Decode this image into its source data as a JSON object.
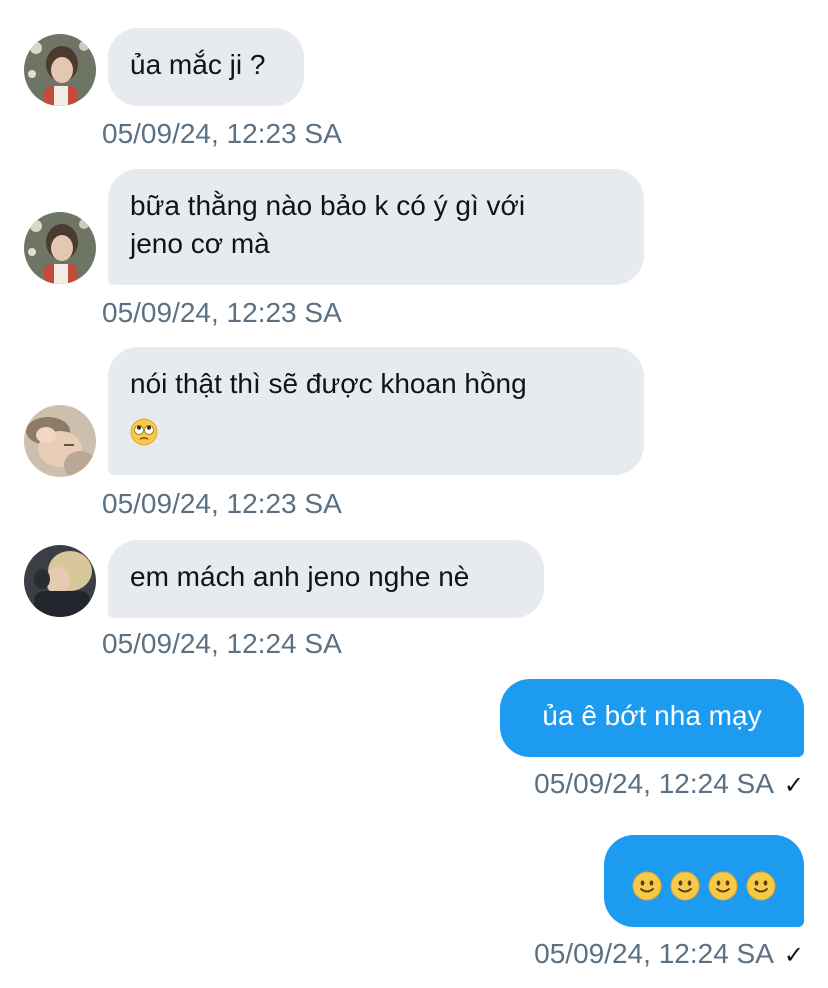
{
  "messages": [
    {
      "direction": "incoming",
      "avatar": "avatar-1",
      "text": "ủa mắc ji ?",
      "timestamp": "05/09/24, 12:23 SA"
    },
    {
      "direction": "incoming",
      "avatar": "avatar-1",
      "line1": "bữa thằng nào bảo k có ý gì với",
      "line2": "jeno cơ mà",
      "timestamp": "05/09/24, 12:23 SA"
    },
    {
      "direction": "incoming",
      "avatar": "avatar-2",
      "line1": "nói thật thì sẽ được khoan hồng",
      "emoji": "face-with-rolling-eyes-icon",
      "timestamp": "05/09/24, 12:23 SA"
    },
    {
      "direction": "incoming",
      "avatar": "avatar-3",
      "text": "em mách anh jeno nghe nè",
      "timestamp": "05/09/24, 12:24 SA"
    },
    {
      "direction": "outgoing",
      "text": "ủa ê bớt nha mạy",
      "timestamp": "05/09/24, 12:24 SA",
      "status": "✓"
    },
    {
      "direction": "outgoing",
      "emoji": "slightly-smiling-face-icon",
      "emoji_count": 4,
      "timestamp": "05/09/24, 12:24 SA",
      "status": "✓"
    }
  ],
  "colors": {
    "incoming_bubble": "#e7ebef",
    "outgoing_bubble": "#1d9bf0",
    "timestamp": "#5b7083"
  }
}
